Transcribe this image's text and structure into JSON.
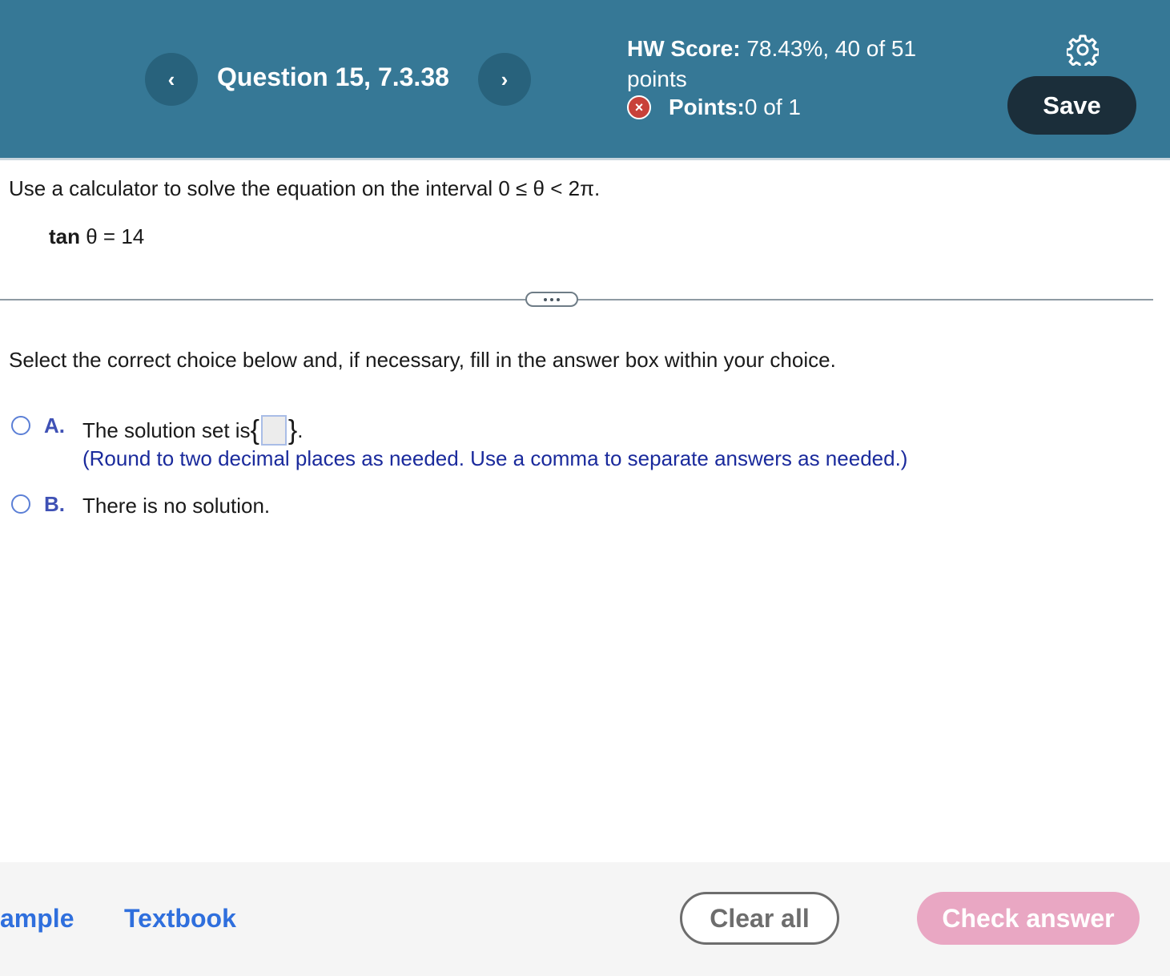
{
  "header": {
    "prev_glyph": "‹",
    "next_glyph": "›",
    "question_title": "Question 15, 7.3.38",
    "hw_score_label": "HW Score:",
    "hw_score_value": " 78.43%, 40 of 51 points",
    "points_label": "Points:",
    "points_value": " 0 of 1",
    "points_status_glyph": "×",
    "save_label": "Save",
    "colors": {
      "header_bg": "#367896",
      "nav_button": "#28627c",
      "save_button": "#1b2e3a",
      "incorrect": "#c8413a"
    }
  },
  "question": {
    "instruction": "Use a calculator to solve the equation on the interval 0 ≤ θ < 2π.",
    "equation_fn": "tan",
    "equation_rest": " θ = 14",
    "more_glyph": "•••"
  },
  "answer": {
    "prompt": "Select the correct choice below and, if necessary, fill in the answer box within your choice.",
    "choices": [
      {
        "letter": "A.",
        "text": "The solution set is ",
        "open_brace": "{",
        "close_brace": "}",
        "after": ".",
        "box_value": "",
        "hint": "(Round to two decimal places as needed. Use a comma to separate answers as needed.)"
      },
      {
        "letter": "B.",
        "text": "There is no solution."
      }
    ]
  },
  "footer": {
    "example_label": "ample",
    "textbook_label": "Textbook",
    "clear_label": "Clear all",
    "check_label": "Check answer",
    "colors": {
      "link": "#2f6fdd",
      "check_button": "#e9a7c3"
    }
  }
}
